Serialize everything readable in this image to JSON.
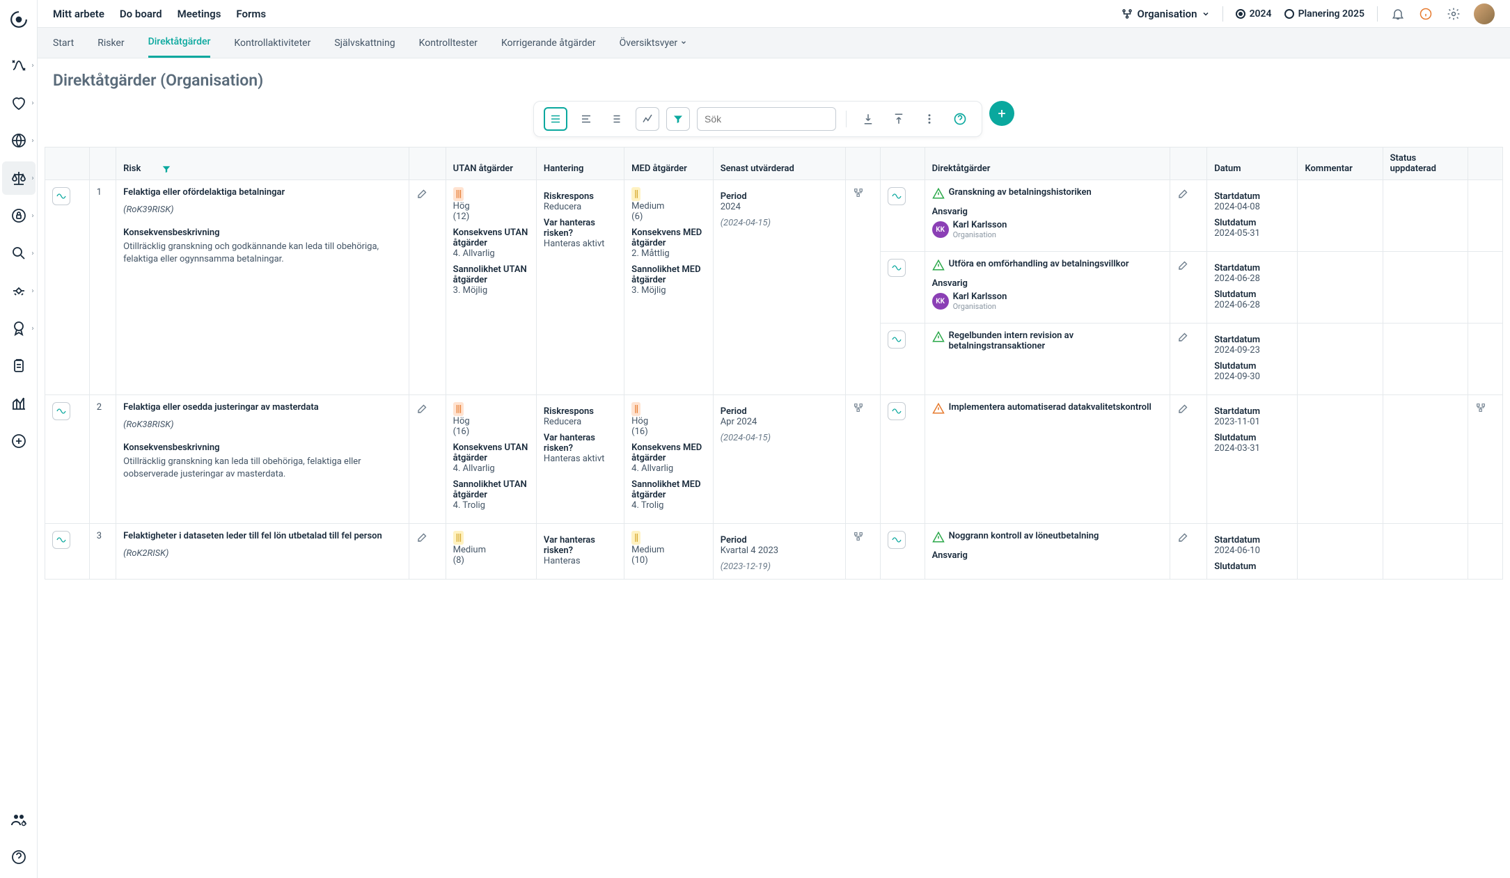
{
  "topnav": {
    "items": [
      "Mitt arbete",
      "Do board",
      "Meetings",
      "Forms"
    ],
    "org_label": "Organisation",
    "year_current": "2024",
    "year_planning": "Planering 2025"
  },
  "subnav": {
    "items": [
      "Start",
      "Risker",
      "Direktåtgärder",
      "Kontrollaktiviteter",
      "Självskattning",
      "Kontrolltester",
      "Korrigerande åtgärder",
      "Översiktsvyer"
    ],
    "active_index": 2
  },
  "page_title": "Direktåtgärder (Organisation)",
  "search_placeholder": "Sök",
  "columns": {
    "risk": "Risk",
    "utan": "UTAN åtgärder",
    "hantering": "Hantering",
    "med": "MED åtgärder",
    "senast": "Senast utvärderad",
    "direkt": "Direktåtgärder",
    "datum": "Datum",
    "kommentar": "Kommentar",
    "status": "Status uppdaterad"
  },
  "labels": {
    "konsekvensbeskrivning": "Konsekvensbeskrivning",
    "konsekvens_utan": "Konsekvens UTAN åtgärder",
    "sannolikhet_utan": "Sannolikhet UTAN åtgärder",
    "konsekvens_med": "Konsekvens MED åtgärder",
    "sannolikhet_med": "Sannolikhet MED åtgärder",
    "riskrespons": "Riskrespons",
    "var_hanteras": "Var hanteras risken?",
    "period": "Period",
    "ansvarig": "Ansvarig",
    "startdatum": "Startdatum",
    "slutdatum": "Slutdatum"
  },
  "rows": [
    {
      "num": "1",
      "title": "Felaktiga eller ofördelaktiga betalningar",
      "code": "(RoK39RISK)",
      "konsekvens_desc": "Otillräcklig granskning och godkännande kan leda till obehöriga, felaktiga eller ogynnsamma betalningar.",
      "utan": {
        "level": "Hög",
        "level_class": "lvl-high",
        "score": "(12)",
        "konsekvens": "4. Allvarlig",
        "sannolikhet": "3. Möjlig"
      },
      "hantering": {
        "respons": "Reducera",
        "var": "Hanteras aktivt"
      },
      "med": {
        "level": "Medium",
        "level_class": "lvl-med",
        "score": "(6)",
        "konsekvens": "2. Måttlig",
        "sannolikhet": "3. Möjlig"
      },
      "period": {
        "label": "2024",
        "date": "(2024-04-15)"
      },
      "actions": [
        {
          "title": "Granskning av betalningshistoriken",
          "warn": "green",
          "start": "2024-04-08",
          "end": "2024-05-31",
          "resp_name": "Karl Karlsson",
          "resp_org": "Organisation",
          "resp_initials": "KK"
        },
        {
          "title": "Utföra en omförhandling av betalningsvillkor",
          "warn": "green",
          "start": "2024-06-28",
          "end": "2024-06-28",
          "resp_name": "Karl Karlsson",
          "resp_org": "Organisation",
          "resp_initials": "KK"
        },
        {
          "title": "Regelbunden intern revision av betalningstransaktioner",
          "warn": "green",
          "start": "2024-09-23",
          "end": "2024-09-30"
        }
      ]
    },
    {
      "num": "2",
      "title": "Felaktiga eller osedda justeringar av masterdata",
      "code": "(RoK38RISK)",
      "konsekvens_desc": "Otillräcklig granskning kan leda till obehöriga, felaktiga eller oobserverade justeringar av masterdata.",
      "utan": {
        "level": "Hög",
        "level_class": "lvl-high",
        "score": "(16)",
        "konsekvens": "4. Allvarlig",
        "sannolikhet": "4. Trolig"
      },
      "hantering": {
        "respons": "Reducera",
        "var": "Hanteras aktivt"
      },
      "med": {
        "level": "Hög",
        "level_class": "lvl-high",
        "score": "(16)",
        "konsekvens": "4. Allvarlig",
        "sannolikhet": "4. Trolig"
      },
      "period": {
        "label": "Apr 2024",
        "date": "(2024-04-15)"
      },
      "actions": [
        {
          "title": "Implementera automatiserad datakvalitetskontroll",
          "warn": "orange",
          "start": "2023-11-01",
          "end": "2024-03-31"
        }
      ]
    },
    {
      "num": "3",
      "title": "Felaktigheter i dataseten leder till fel lön utbetalad till fel person",
      "code": "(RoK2RISK)",
      "konsekvens_desc": "",
      "utan": {
        "level": "Medium",
        "level_class": "lvl-med",
        "score": "(8)",
        "konsekvens": "",
        "sannolikhet": ""
      },
      "hantering": {
        "respons": "",
        "var": "Hanteras"
      },
      "med": {
        "level": "Medium",
        "level_class": "lvl-med",
        "score": "(10)",
        "konsekvens": "",
        "sannolikhet": ""
      },
      "period": {
        "label": "Kvartal 4 2023",
        "date": "(2023-12-19)"
      },
      "actions": [
        {
          "title": "Noggrann kontroll av löneutbetalning",
          "warn": "green",
          "start": "2024-06-10",
          "end": "",
          "resp_label_only": true
        }
      ]
    }
  ]
}
